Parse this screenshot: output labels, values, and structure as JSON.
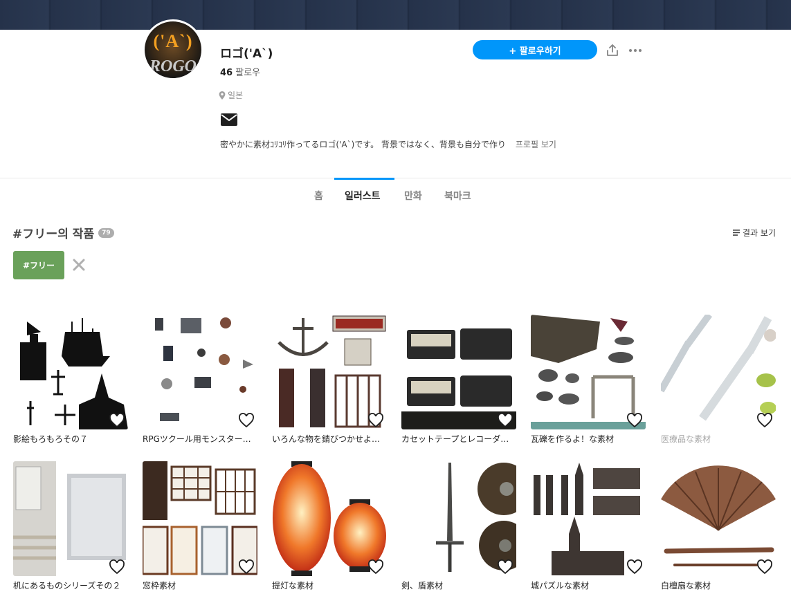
{
  "profile": {
    "name": "ロゴ('A`)",
    "avatar_text_top": "('A`)",
    "avatar_text_bottom": "ROGO",
    "follow_count": "46",
    "follow_label": "팔로우",
    "location": "일본",
    "bio": "密やかに素材ｺﾘｺﾘ作ってるロゴ('A`)です。 背景ではなく、背景も自分で作り",
    "profile_link": "프로필 보기",
    "follow_button": "+ 팔로우하기"
  },
  "tabs": [
    {
      "label": "홈"
    },
    {
      "label": "일러스트"
    },
    {
      "label": "만화"
    },
    {
      "label": "북마크"
    }
  ],
  "section": {
    "title": "#フリー의 작품",
    "count": "79",
    "result_view": "결과 보기"
  },
  "filter": {
    "tag": "#フリー"
  },
  "works": [
    {
      "title": "影絵もろもろその７"
    },
    {
      "title": "RPGツクール用モンスター素材"
    },
    {
      "title": "いろんな物を錆びつかせよう素材"
    },
    {
      "title": "カセットテープとレコーダー素材"
    },
    {
      "title": "瓦礫を作るよ！な素材"
    },
    {
      "title": "医療品な素材"
    },
    {
      "title": "机にあるものシリーズその２"
    },
    {
      "title": "窓枠素材"
    },
    {
      "title": "提灯な素材"
    },
    {
      "title": "剣、盾素材"
    },
    {
      "title": "城パズルな素材"
    },
    {
      "title": "白檀扇な素材"
    }
  ],
  "colors": {
    "accent": "#0096fa",
    "tag_chip": "#6aa15a"
  }
}
